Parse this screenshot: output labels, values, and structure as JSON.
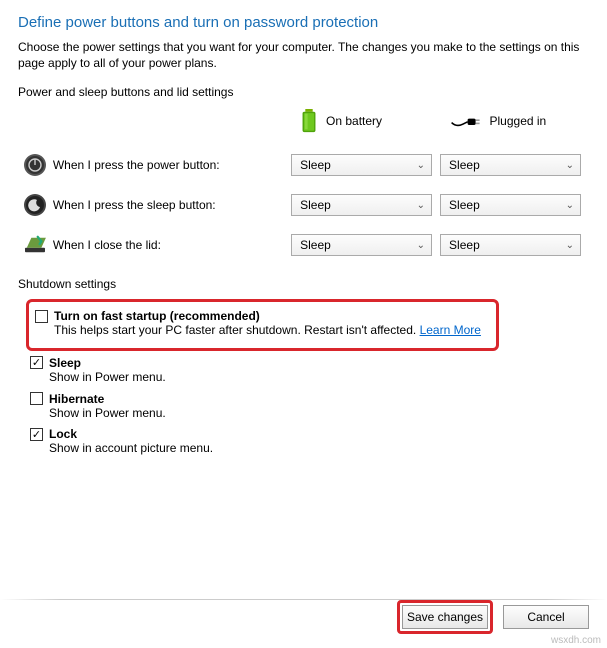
{
  "title": "Define power buttons and turn on password protection",
  "subtitle": "Choose the power settings that you want for your computer. The changes you make to the settings on this page apply to all of your power plans.",
  "section_label": "Power and sleep buttons and lid settings",
  "columns": {
    "battery": "On battery",
    "plugged": "Plugged in"
  },
  "rows": [
    {
      "label": "When I press the power button:",
      "battery_value": "Sleep",
      "plugged_value": "Sleep"
    },
    {
      "label": "When I press the sleep button:",
      "battery_value": "Sleep",
      "plugged_value": "Sleep"
    },
    {
      "label": "When I close the lid:",
      "battery_value": "Sleep",
      "plugged_value": "Sleep"
    }
  ],
  "shutdown_label": "Shutdown settings",
  "shutdown_items": [
    {
      "checked": false,
      "title": "Turn on fast startup (recommended)",
      "desc": "This helps start your PC faster after shutdown. Restart isn't affected. ",
      "link": "Learn More"
    },
    {
      "checked": true,
      "title": "Sleep",
      "desc": "Show in Power menu."
    },
    {
      "checked": false,
      "title": "Hibernate",
      "desc": "Show in Power menu."
    },
    {
      "checked": true,
      "title": "Lock",
      "desc": "Show in account picture menu."
    }
  ],
  "buttons": {
    "save": "Save changes",
    "cancel": "Cancel"
  },
  "watermark": "wsxdh.com"
}
